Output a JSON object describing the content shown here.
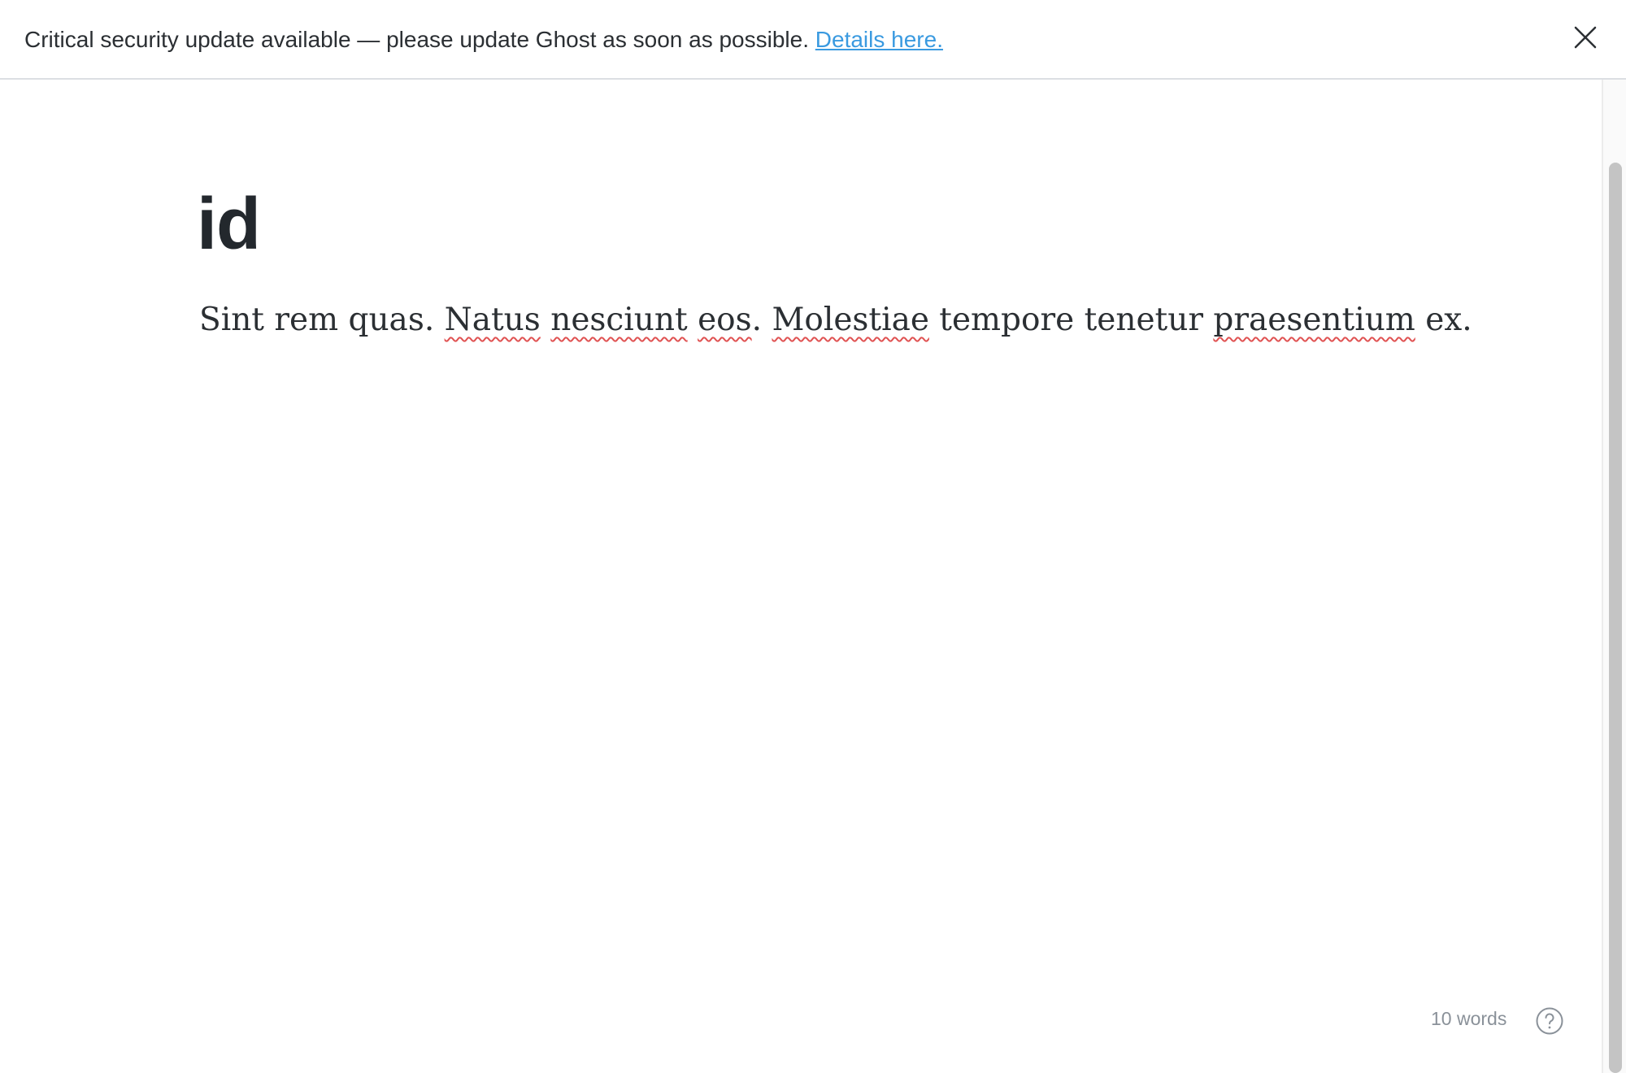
{
  "banner": {
    "message": "Critical security update available — please update Ghost as soon as possible.",
    "link_label": "Details here.",
    "close_icon": "close-icon"
  },
  "editor": {
    "title": "id",
    "body_parts": [
      {
        "text": "Sint rem quas. ",
        "misspelled": false
      },
      {
        "text": "Natus",
        "misspelled": true
      },
      {
        "text": " ",
        "misspelled": false
      },
      {
        "text": "nesciunt",
        "misspelled": true
      },
      {
        "text": " ",
        "misspelled": false
      },
      {
        "text": "eos",
        "misspelled": true
      },
      {
        "text": ". ",
        "misspelled": false
      },
      {
        "text": "Molestiae",
        "misspelled": true
      },
      {
        "text": " tempore tenetur ",
        "misspelled": false
      },
      {
        "text": "praesentium",
        "misspelled": true
      },
      {
        "text": " ex.",
        "misspelled": false
      }
    ]
  },
  "footer": {
    "word_count": "10 words",
    "help_icon": "help-circle-icon"
  },
  "colors": {
    "link": "#3a9ae0",
    "text": "#2b2f33",
    "title": "#23282d",
    "muted": "#8a9199",
    "spellcheck": "#e05252"
  }
}
